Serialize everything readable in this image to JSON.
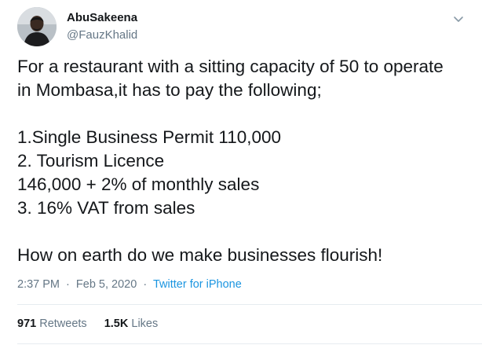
{
  "user": {
    "name": "AbuSakeena",
    "handle": "@FauzKhalid"
  },
  "tweet": {
    "lines": [
      "For a restaurant with a sitting capacity of 50 to operate",
      "in Mombasa,it has to pay the following;",
      "",
      "1.Single Business Permit 110,000",
      "2. Tourism Licence",
      "146,000 + 2% of monthly sales",
      "3. 16% VAT from sales",
      "",
      "How on earth do we make businesses flourish!"
    ]
  },
  "meta": {
    "time": "2:37 PM",
    "separator1": "·",
    "date": "Feb 5, 2020",
    "separator2": "·",
    "source": "Twitter for iPhone"
  },
  "stats": {
    "retweets_count": "971",
    "retweets_label": "Retweets",
    "likes_count": "1.5K",
    "likes_label": "Likes"
  },
  "icons": {
    "caret": "chevron-down-icon"
  },
  "colors": {
    "text": "#14171a",
    "secondary": "#657786",
    "link": "#1b95e0",
    "divider": "#e6ecf0"
  }
}
